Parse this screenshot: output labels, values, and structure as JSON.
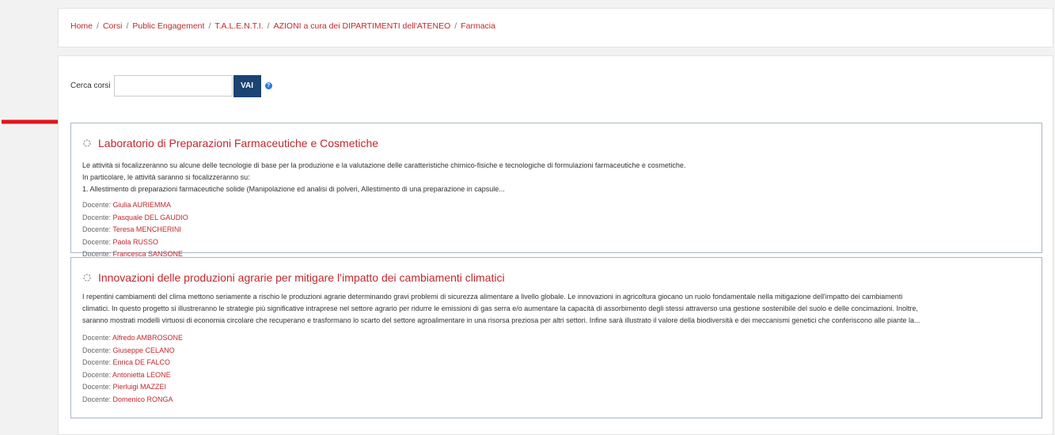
{
  "breadcrumb": {
    "separator": "/",
    "items": [
      "Home",
      "Corsi",
      "Public Engagement",
      "T.A.L.E.N.T.I.",
      "AZIONI a cura dei DIPARTIMENTI dell'ATENEO",
      "Farmacia"
    ]
  },
  "search": {
    "label": "Cerca corsi",
    "value": "",
    "button_label": "VAI",
    "help_glyph": "?"
  },
  "courses": [
    {
      "title": "Laboratorio di Preparazioni Farmaceutiche e Cosmetiche",
      "summary": [
        "Le attività si focalizzeranno su alcune delle tecnologie di base per la produzione e la valutazione delle caratteristiche chimico-fisiche e tecnologiche di formulazioni farmaceutiche e cosmetiche.",
        "In particolare, le attività saranno si focalizzeranno su:",
        "1. Allestimento di preparazioni farmaceutiche solide (Manipolazione ed analisi di polveri, Allestimento di una preparazione in capsule..."
      ],
      "teacher_label": "Docente: ",
      "teachers": [
        "Giulia AURIEMMA",
        "Pasquale DEL GAUDIO",
        "Teresa MENCHERINI",
        "Paola RUSSO",
        "Francesca SANSONE"
      ]
    },
    {
      "title": "Innovazioni delle produzioni agrarie per mitigare l’impatto dei cambiamenti climatici",
      "summary": [
        "I repentini cambiamenti del clima mettono seriamente a rischio le produzioni agrarie determinando gravi problemi di sicurezza alimentare a livello globale. Le innovazioni in agricoltura giocano un ruolo fondamentale nella mitigazione dell'impatto dei cambiamenti",
        "climatici. In questo progetto si illustreranno le strategie più significative intraprese nel settore agrario per ridurre le emissioni di gas serra e/o aumentare la capacità di assorbimento degli stessi attraverso una gestione sostenibile del suolo e delle concimazioni. Inoltre,",
        "saranno mostrati modelli virtuosi di economia circolare che recuperano e trasformano lo scarto del settore agroalimentare in una risorsa preziosa per altri settori. Infine sarà illustrato il valore della biodiversità e dei meccanismi genetici che conferiscono alle piante la..."
      ],
      "teacher_label": "Docente: ",
      "teachers": [
        "Alfredo AMBROSONE",
        "Giuseppe CELANO",
        "Enrica DE FALCO",
        "Antonietta LEONE",
        "Pierluigi MAZZEI",
        "Domenico RONGA"
      ]
    }
  ],
  "colors": {
    "link": "#c1272d",
    "button": "#1b4373",
    "help": "#2b7bd6",
    "arrow": "#e3141b",
    "card_border": "#a9b6c6"
  },
  "icons": {
    "course": "course-icon",
    "help": "help-icon",
    "arrow": "pointer-arrow"
  }
}
